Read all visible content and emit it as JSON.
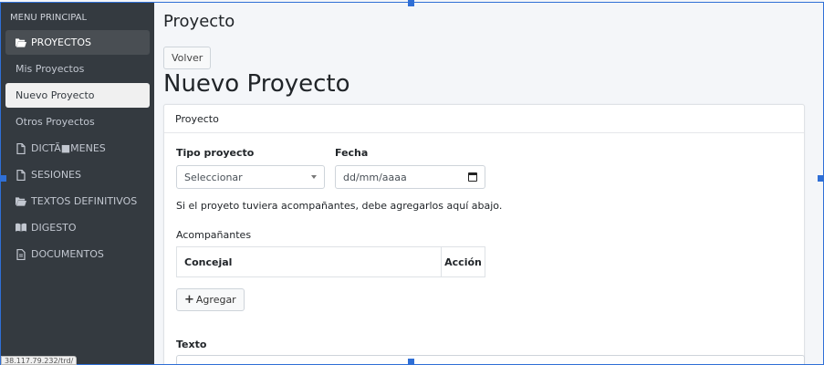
{
  "sidebar": {
    "header": "MENU PRINCIPAL",
    "items": [
      {
        "label": "PROYECTOS",
        "icon": "folder-open-icon"
      },
      {
        "label": "Mis Proyectos"
      },
      {
        "label": "Nuevo Proyecto"
      },
      {
        "label": "Otros Proyectos"
      },
      {
        "label": "DICTÃ■MENES",
        "icon": "file-icon"
      },
      {
        "label": "SESIONES",
        "icon": "file-icon"
      },
      {
        "label": "TEXTOS DEFINITIVOS",
        "icon": "folder-open-icon"
      },
      {
        "label": "DIGESTO",
        "icon": "book-icon"
      },
      {
        "label": "DOCUMENTOS",
        "icon": "file-text-icon"
      }
    ]
  },
  "status_url": "38.117.79.232/trd/",
  "main": {
    "page_title": "Proyecto",
    "back_button": "Volver",
    "heading": "Nuevo Proyecto",
    "card_header": "Proyecto",
    "tipo_label": "Tipo proyecto",
    "tipo_value": "Seleccionar",
    "fecha_label": "Fecha",
    "fecha_placeholder": "dd/mm/aaaa",
    "info_text": "Si el proyeto tuviera acompañantes, debe agregarlos aquí abajo.",
    "acompanantes_label": "Acompañantes",
    "table_headers": [
      "Concejal",
      "Acción"
    ],
    "add_button": "Agregar",
    "texto_label": "Texto"
  }
}
